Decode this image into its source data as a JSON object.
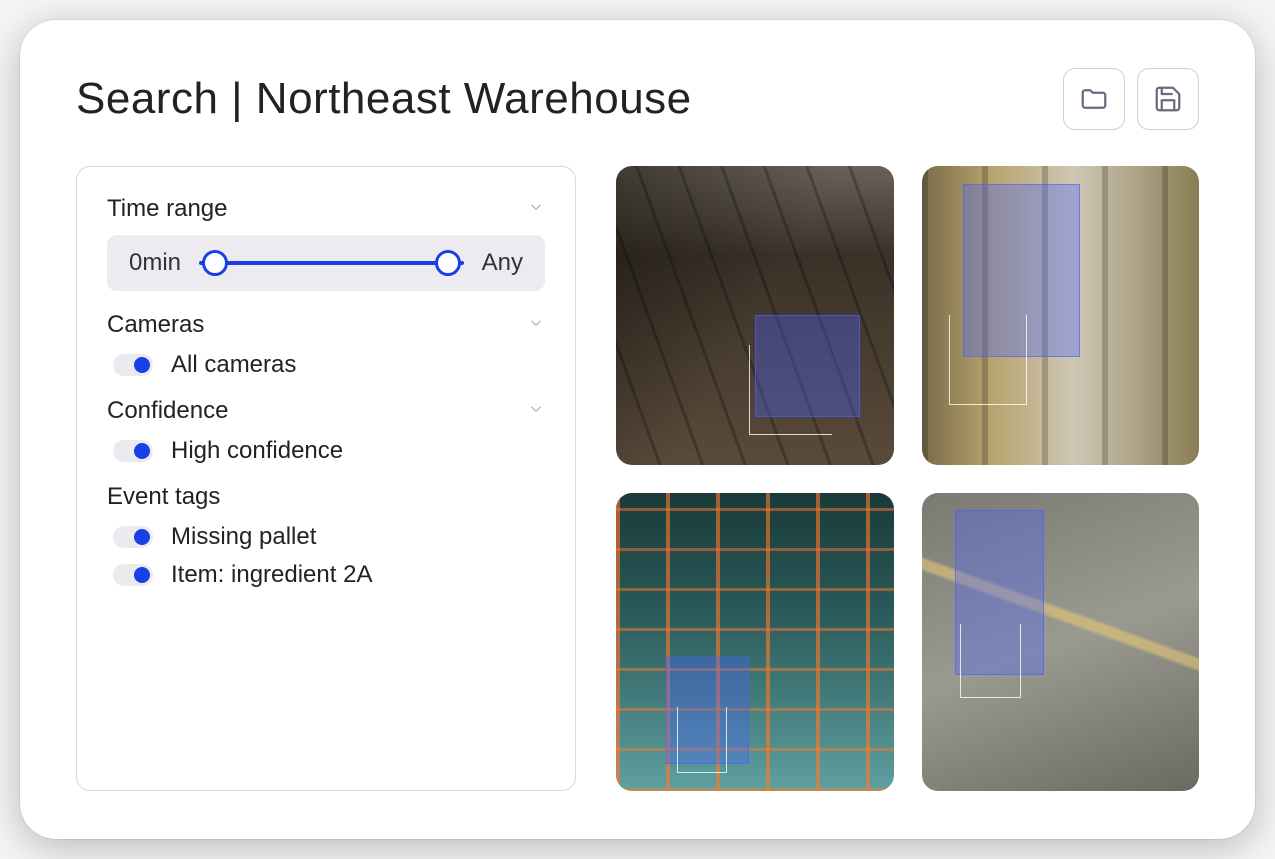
{
  "header": {
    "title": "Search | Northeast Warehouse",
    "folder_icon": "folder-icon",
    "save_icon": "save-icon"
  },
  "filters": {
    "time_range": {
      "label": "Time range",
      "min_label": "0min",
      "max_label": "Any"
    },
    "cameras": {
      "label": "Cameras",
      "items": [
        "All cameras"
      ]
    },
    "confidence": {
      "label": "Confidence",
      "items": [
        "High confidence"
      ]
    },
    "event_tags": {
      "label": "Event tags",
      "items": [
        "Missing pallet",
        "Item: ingredient 2A"
      ]
    }
  },
  "results": {
    "thumbnails": [
      {
        "name": "warehouse-shelving-dark"
      },
      {
        "name": "warehouse-aisle-yellow-racks"
      },
      {
        "name": "warehouse-blue-orange-racks"
      },
      {
        "name": "warehouse-forklift-pallets"
      }
    ]
  },
  "colors": {
    "accent": "#1a3fe6"
  }
}
